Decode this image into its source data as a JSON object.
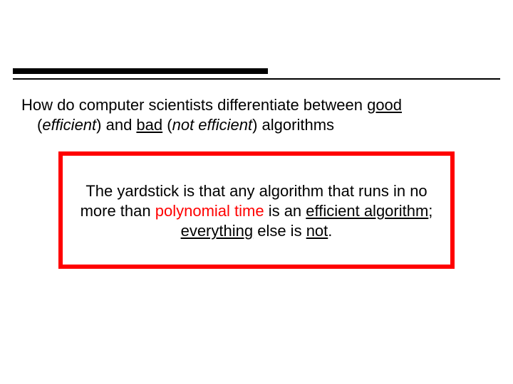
{
  "body": {
    "l1a": "How do computer scientists differentiate between ",
    "l1_good": "good",
    "l2a": "(",
    "l2_efficient": "efficient",
    "l2b": ") and ",
    "l2_bad": "bad",
    "l2c": " (",
    "l2_notefficient": "not efficient",
    "l2d": ") algorithms"
  },
  "callout": {
    "p1a": "The yardstick is that any algorithm that  runs in no",
    "p2a": "more than ",
    "p2_poly": "polynomial time",
    "p2b": " is an ",
    "p2_eff": "efficient algorithm",
    "p2c": ";",
    "p3_everything": "everything",
    "p3b": " else is ",
    "p3_not": "not",
    "p3c": "."
  }
}
